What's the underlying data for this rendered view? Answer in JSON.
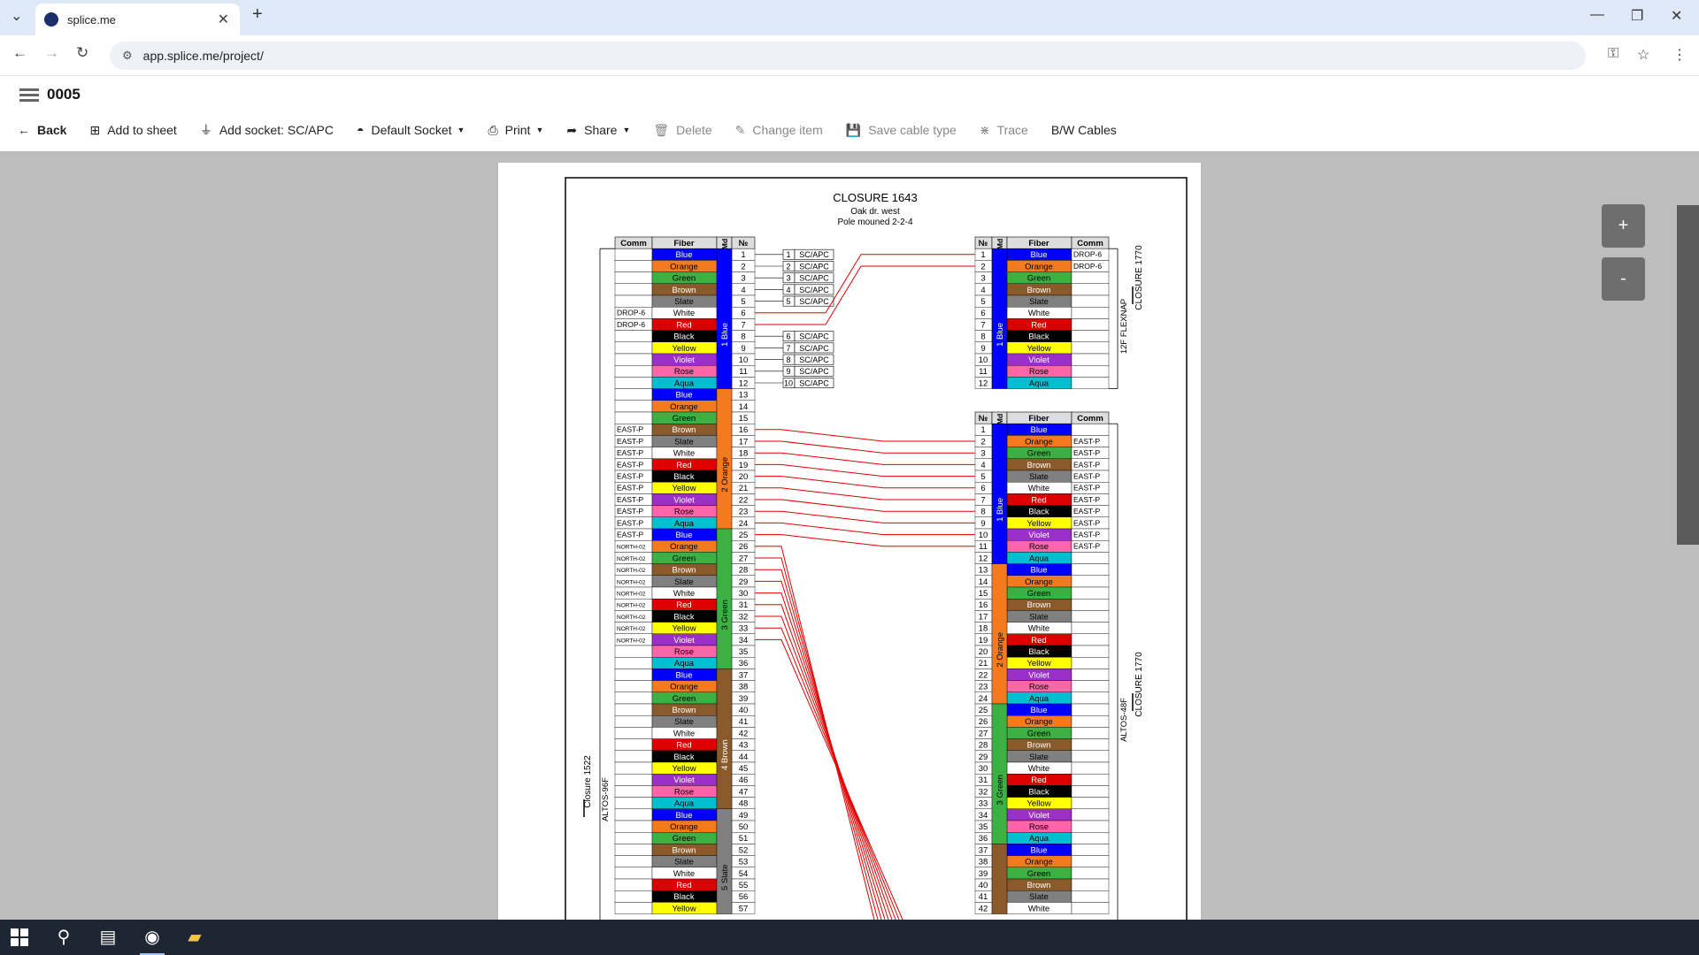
{
  "browser": {
    "tab_title": "splice.me",
    "url": "app.splice.me/project/"
  },
  "app": {
    "project_title": "0005",
    "toolbar": {
      "back": "Back",
      "add_to_sheet": "Add to sheet",
      "add_socket": "Add socket: SC/APC",
      "default_socket": "Default Socket",
      "print": "Print",
      "share": "Share",
      "delete": "Delete",
      "change_item": "Change item",
      "save_cable_type": "Save cable type",
      "trace": "Trace",
      "bw_cables": "B/W Cables"
    },
    "zoom_in": "+",
    "zoom_out": "-"
  },
  "diagram": {
    "title": "CLOSURE 1643",
    "subtitle1": "Oak dr. west",
    "subtitle2": "Pole mouned 2-2-4",
    "headers": {
      "comm": "Comm",
      "fiber": "Fiber",
      "md": "Md",
      "no": "№"
    },
    "colors": [
      "Blue",
      "Orange",
      "Green",
      "Brown",
      "Slate",
      "White",
      "Red",
      "Black",
      "Yellow",
      "Violet",
      "Rose",
      "Aqua"
    ],
    "color_hex": {
      "Blue": "#0000ff",
      "Orange": "#f47a20",
      "Green": "#3cb043",
      "Brown": "#8b5a2b",
      "Slate": "#808080",
      "White": "#ffffff",
      "Red": "#dd0000",
      "Black": "#000000",
      "Yellow": "#ffff00",
      "Violet": "#9b30c8",
      "Rose": "#ff66aa",
      "Aqua": "#00c0d0"
    },
    "tube_names": [
      "1 Blue",
      "2 Orange",
      "3 Green",
      "4 Brown",
      "5 Slate"
    ],
    "left_cable": {
      "name": "Closure 1522",
      "type": "ALTOS-96F",
      "visible_fibers": 57,
      "comm": {
        "6": "DROP-6",
        "7": "DROP-6",
        "16": "EAST-P",
        "17": "EAST-P",
        "18": "EAST-P",
        "19": "EAST-P",
        "20": "EAST-P",
        "21": "EAST-P",
        "22": "EAST-P",
        "23": "EAST-P",
        "24": "EAST-P",
        "25": "EAST-P",
        "26": "NORTH-02",
        "27": "NORTH-02",
        "28": "NORTH-02",
        "29": "NORTH-02",
        "30": "NORTH-02",
        "31": "NORTH-02",
        "32": "NORTH-02",
        "33": "NORTH-02",
        "34": "NORTH-02"
      }
    },
    "sockets": [
      {
        "fiber": 1,
        "label": "1 SC/APC"
      },
      {
        "fiber": 2,
        "label": "2 SC/APC"
      },
      {
        "fiber": 3,
        "label": "3 SC/APC"
      },
      {
        "fiber": 4,
        "label": "4 SC/APC"
      },
      {
        "fiber": 5,
        "label": "5 SC/APC"
      },
      {
        "fiber": 8,
        "label": "6 SC/APC"
      },
      {
        "fiber": 9,
        "label": "7 SC/APC"
      },
      {
        "fiber": 10,
        "label": "8 SC/APC"
      },
      {
        "fiber": 11,
        "label": "9 SC/APC"
      },
      {
        "fiber": 12,
        "label": "10 SC/APC"
      }
    ],
    "right_cable1": {
      "name": "CLOSURE 1770",
      "type": "12F FLEXNAP",
      "fibers": 12,
      "comm": {
        "1": "DROP-6",
        "2": "DROP-6"
      }
    },
    "right_cable2": {
      "name": "CLOSURE 1770",
      "type": "ALTOS-48F",
      "visible_fibers": 42,
      "comm": {
        "2": "EAST-P",
        "3": "EAST-P",
        "4": "EAST-P",
        "5": "EAST-P",
        "6": "EAST-P",
        "7": "EAST-P",
        "8": "EAST-P",
        "9": "EAST-P",
        "10": "EAST-P",
        "11": "EAST-P"
      }
    },
    "splices_to_cable1": [
      [
        6,
        1
      ],
      [
        7,
        2
      ]
    ],
    "splices_to_cable2": [
      [
        16,
        2
      ],
      [
        17,
        3
      ],
      [
        18,
        4
      ],
      [
        19,
        5
      ],
      [
        20,
        6
      ],
      [
        21,
        7
      ],
      [
        22,
        8
      ],
      [
        23,
        9
      ],
      [
        24,
        10
      ],
      [
        25,
        11
      ]
    ],
    "splices_offsheet": [
      26,
      27,
      28,
      29,
      30,
      31,
      32,
      33,
      34
    ]
  },
  "taskbar": {
    "items": [
      "start-icon",
      "search-icon",
      "notepad-icon",
      "chrome-icon",
      "file-explorer-icon"
    ]
  }
}
